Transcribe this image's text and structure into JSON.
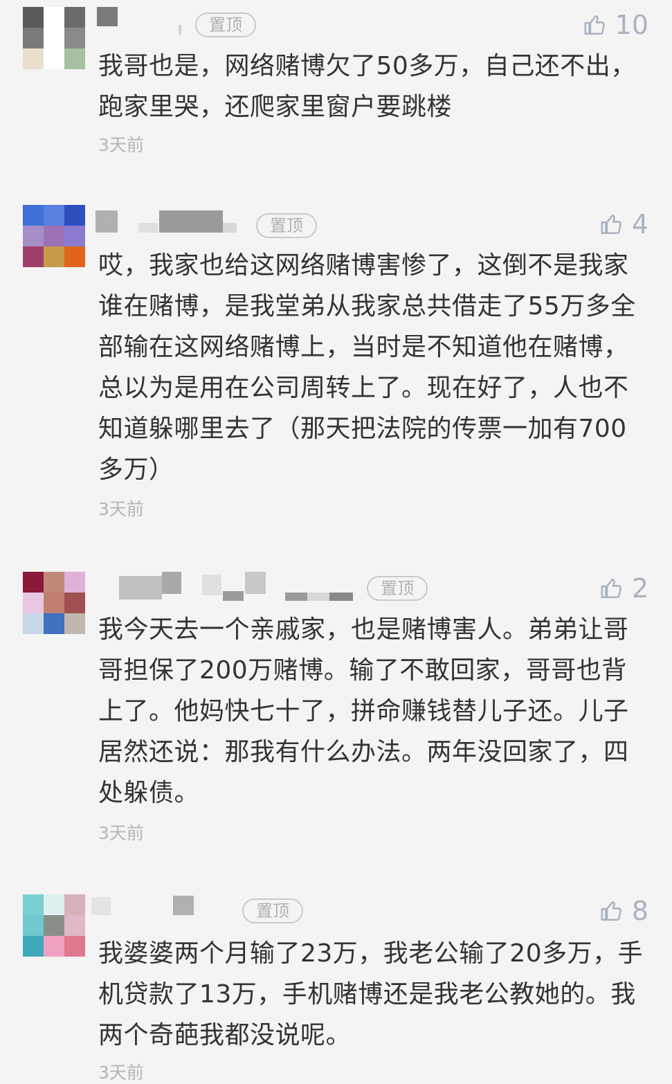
{
  "comments": [
    {
      "pin_label": "置顶",
      "likes": "10",
      "text": "我哥也是，网络赌博欠了50多万，自己还不出，跑家里哭，还爬家里窗户要跳楼",
      "time": "3天前",
      "avatar_colors": [
        "#5a5a5a",
        "#ffffff",
        "#6b6b6b",
        "#7a7a7a",
        "#ffffff",
        "#8a8a8a",
        "#e8e0cc",
        "#ffffff",
        "#a7c0a0"
      ]
    },
    {
      "pin_label": "置顶",
      "likes": "4",
      "text": "哎，我家也给这网络赌博害惨了，这倒不是我家谁在赌博，是我堂弟从我家总共借走了55万多全部输在这网络赌博上，当时是不知道他在赌博，总以为是用在公司周转上了。现在好了，人也不知道躲哪里去了（那天把法院的传票一加有700多万）",
      "time": "3天前",
      "avatar_colors": [
        "#3e6fd8",
        "#5b7fe0",
        "#2f4fc0",
        "#a58fc7",
        "#9a72b5",
        "#8a7bd0",
        "#a0406a",
        "#c79a4a",
        "#e0651a"
      ]
    },
    {
      "pin_label": "置顶",
      "likes": "2",
      "text": "我今天去一个亲戚家，也是赌博害人。弟弟让哥哥担保了200万赌博。输了不敢回家，哥哥也背上了。他妈快七十了，拼命赚钱替儿子还。儿子居然还说：那我有什么办法。两年没回家了，四处躲债。",
      "time": "3天前",
      "avatar_colors": [
        "#8a1a3a",
        "#c08a7a",
        "#e0b0d8",
        "#e8c8e0",
        "#c08070",
        "#a05050",
        "#c8d8e8",
        "#4070c0",
        "#c0b8b0"
      ]
    },
    {
      "pin_label": "置顶",
      "likes": "8",
      "text": "我婆婆两个月输了23万，我老公输了20多万，手机贷款了13万，手机赌博还是我老公教她的。我两个奇葩我都没说呢。",
      "time": "3天前",
      "avatar_colors": [
        "#7ad0d0",
        "#e0f0f0",
        "#d8b0b8",
        "#70c8d0",
        "#889088",
        "#e0b8c8",
        "#40a8b8",
        "#f0a0c0",
        "#e07890"
      ]
    }
  ],
  "colors": {
    "background": "#f4f4f4",
    "text": "#333333",
    "meta": "#b5b5b5",
    "like": "#a9b2c0"
  }
}
